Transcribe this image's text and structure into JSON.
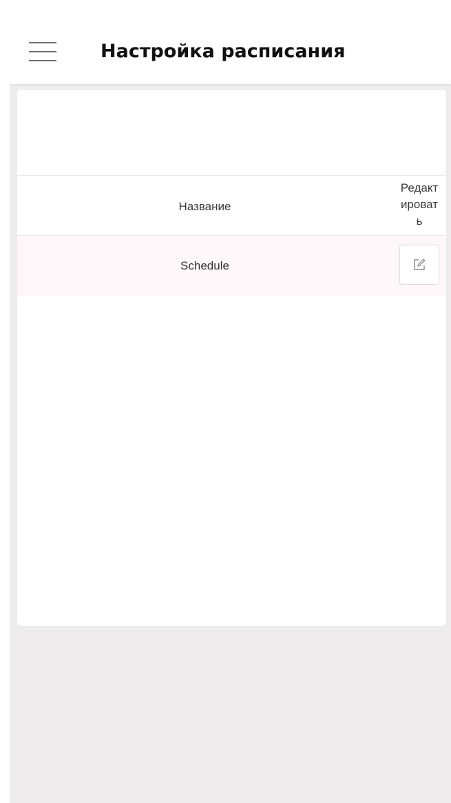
{
  "header": {
    "menu_icon": "hamburger-menu-icon",
    "title": "Настройка расписания"
  },
  "table": {
    "columns": {
      "name": "Название",
      "edit": "Редакт\nироват\nь"
    },
    "rows": [
      {
        "name": "Schedule",
        "edit_icon": "edit-icon"
      }
    ]
  },
  "colors": {
    "page_background": "#efecee",
    "surface": "#ffffff",
    "row_highlight": "#fdf7fa",
    "divider": "#ece8ea",
    "text": "#333333"
  }
}
